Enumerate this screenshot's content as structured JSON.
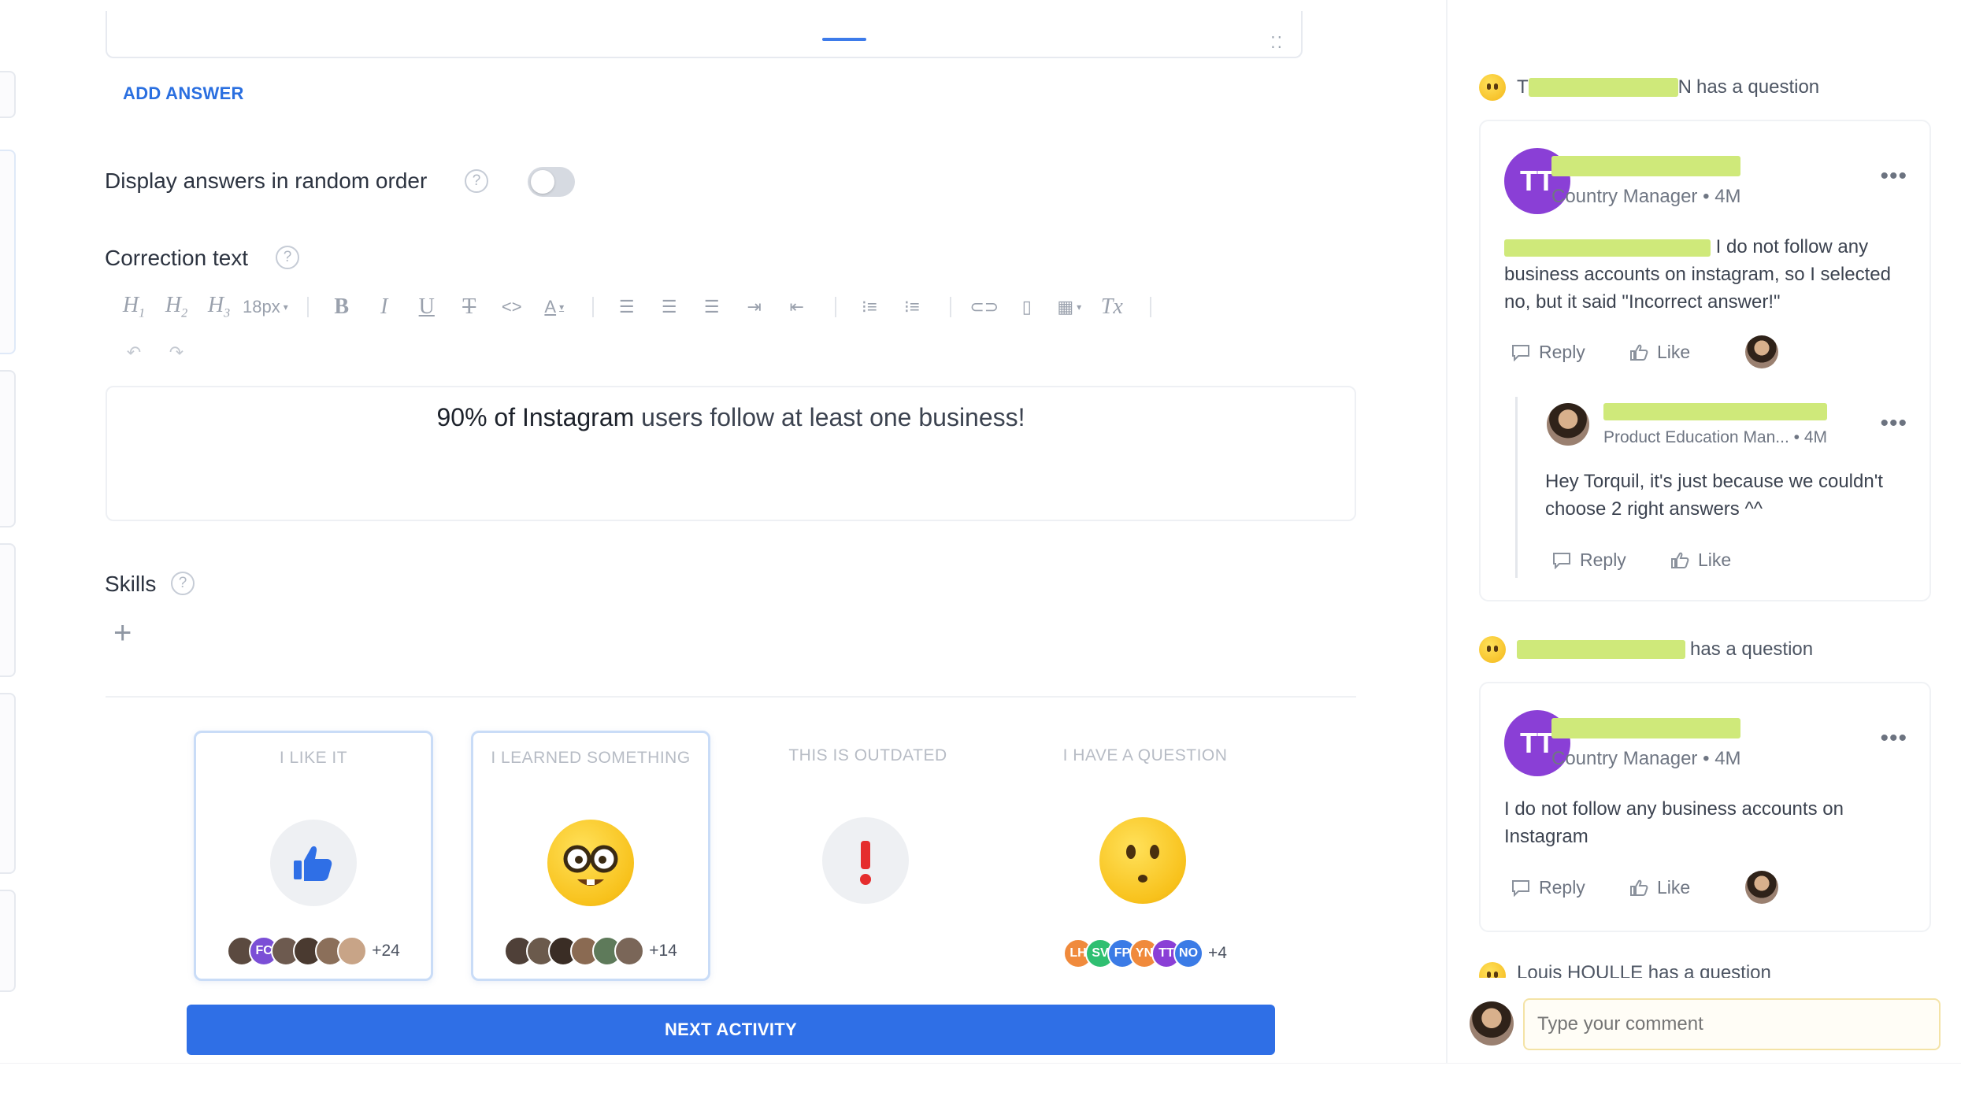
{
  "editor_panel": {
    "add_answer_label": "ADD ANSWER",
    "random_order_label": "Display answers in random order",
    "random_order_enabled": false,
    "correction_label": "Correction text",
    "toolbar": {
      "h1": "H1",
      "h2": "H2",
      "h3": "H3",
      "font_size": "18px",
      "bold": "B",
      "italic": "I",
      "underline": "U",
      "strike": "T",
      "code": "<>",
      "color": "A",
      "clear": "Tx"
    },
    "correction_text_part1": "90% of Instagram",
    "correction_text_part2": " users follow at least one business!",
    "skills_label": "Skills",
    "add_skill": "+"
  },
  "reactions": [
    {
      "title": "I LIKE IT",
      "icon": "thumbs-up-icon",
      "count": "+24",
      "selected": true,
      "avatars": [
        {
          "initials": "",
          "color": "#5b4a40"
        },
        {
          "initials": "FC",
          "color": "#7b4fd6"
        },
        {
          "initials": "",
          "color": "#6d5a4f"
        },
        {
          "initials": "",
          "color": "#4a3a30"
        },
        {
          "initials": "",
          "color": "#8b6f5a"
        },
        {
          "initials": "",
          "color": "#c8a487"
        }
      ]
    },
    {
      "title": "I LEARNED SOMETHING",
      "icon": "nerd-face-icon",
      "count": "+14",
      "selected": true,
      "avatars": [
        {
          "initials": "",
          "color": "#4f4038"
        },
        {
          "initials": "",
          "color": "#6b5a4c"
        },
        {
          "initials": "",
          "color": "#3a2d25"
        },
        {
          "initials": "",
          "color": "#8a6a52"
        },
        {
          "initials": "",
          "color": "#5e7a5a"
        },
        {
          "initials": "",
          "color": "#7a6658"
        }
      ]
    },
    {
      "title": "THIS IS OUTDATED",
      "icon": "exclamation-icon",
      "count": "",
      "selected": false,
      "avatars": []
    },
    {
      "title": "I HAVE A QUESTION",
      "icon": "confused-face-icon",
      "count": "+4",
      "selected": false,
      "avatars": [
        {
          "initials": "LH",
          "color": "#f08a3c"
        },
        {
          "initials": "SV",
          "color": "#2fbf71"
        },
        {
          "initials": "FP",
          "color": "#3b7be6"
        },
        {
          "initials": "YN",
          "color": "#f08a3c"
        },
        {
          "initials": "TT",
          "color": "#8a3fd6"
        },
        {
          "initials": "NO",
          "color": "#3b7be6"
        }
      ]
    }
  ],
  "next_activity_label": "NEXT ACTIVITY",
  "comments_panel": {
    "threads": [
      {
        "header_suffix": "has a question",
        "header_prefix_visible": "T",
        "header_name_end": "N",
        "author_initials": "TT",
        "role": "Country Manager",
        "time": "4M",
        "body_visible": "I do not follow any business accounts on instagram, so I selected no, but it said \"Incorrect answer!\"",
        "reply_label": "Reply",
        "like_label": "Like",
        "reply": {
          "role": "Product Education Man...",
          "time": "4M",
          "body": "Hey Torquil, it's just because we couldn't choose 2 right answers ^^",
          "reply_label": "Reply",
          "like_label": "Like"
        }
      },
      {
        "header_suffix": "has a question",
        "author_initials": "TT",
        "role": "Country Manager",
        "time": "4M",
        "body": "I do not follow any business accounts on Instagram",
        "reply_label": "Reply",
        "like_label": "Like"
      }
    ],
    "third_header_partial": "Louis HOULLE has a question",
    "comment_placeholder": "Type your comment"
  },
  "colors": {
    "accent_blue": "#2f6fe6",
    "avatar_purple": "#8a3fd6",
    "redaction_highlight": "#cfe97a"
  }
}
